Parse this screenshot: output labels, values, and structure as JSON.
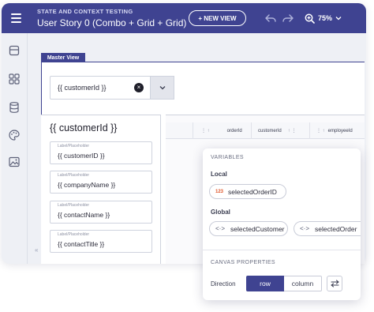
{
  "header": {
    "subtitle": "STATE AND CONTEXT TESTING",
    "title": "User Story 0 (Combo + Grid + Grid)",
    "new_view_label": "+ NEW VIEW",
    "zoom_label": "75%"
  },
  "sidebar": {
    "icons": [
      "layers-icon",
      "grid-icon",
      "database-icon",
      "palette-icon",
      "image-icon"
    ]
  },
  "master_view": {
    "tab_label": "Master View"
  },
  "combo": {
    "value": "{{ customerId }}",
    "clear_symbol": "×"
  },
  "detail": {
    "title": "{{ customerId }}",
    "fields": [
      {
        "label": "Label/Placeholder",
        "value": "{{ customerID }}"
      },
      {
        "label": "Label/Placeholder",
        "value": "{{ companyName }}"
      },
      {
        "label": "Label/Placeholder",
        "value": "{{ contactName }}"
      },
      {
        "label": "Label/Placeholder",
        "value": "{{ contactTitle }}"
      }
    ]
  },
  "grid": {
    "columns": [
      {
        "label": "orderId"
      },
      {
        "label": "customerId"
      },
      {
        "label": "employeeId"
      }
    ]
  },
  "variables_panel": {
    "title": "VARIABLES",
    "local_label": "Local",
    "local_vars": [
      {
        "badge": "123",
        "name": "selectedOrderID"
      }
    ],
    "global_label": "Global",
    "global_vars": [
      {
        "badge": "<·>",
        "name": "selectedCustomer"
      },
      {
        "badge": "<·>",
        "name": "selectedOrder"
      }
    ],
    "canvas_title": "CANVAS PROPERTIES",
    "direction_label": "Direction",
    "direction_options": [
      "row",
      "column"
    ],
    "direction_selected": "row"
  },
  "colors": {
    "primary": "#3f4391",
    "badge_orange": "#e0572b",
    "canvas_bg": "#eef0f5"
  }
}
